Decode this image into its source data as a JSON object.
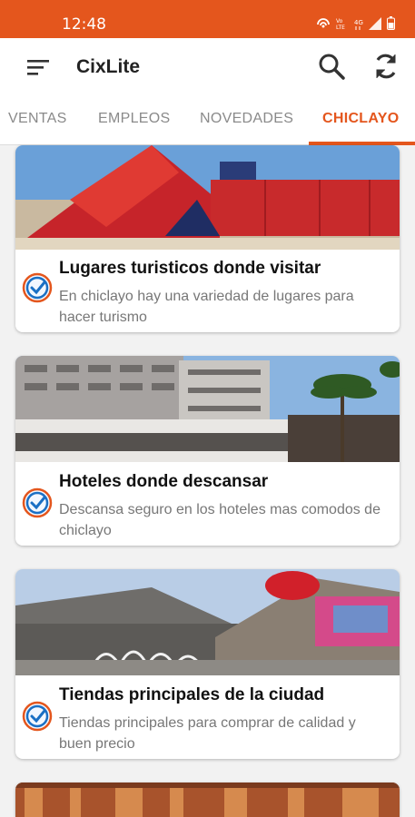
{
  "status_bar": {
    "time": "12:48",
    "icons": [
      "hotspot-icon",
      "volte-icon",
      "4g-icon",
      "signal-icon",
      "battery-icon"
    ]
  },
  "app_bar": {
    "title": "CixLite",
    "accent": "#e4561d"
  },
  "tabs": [
    {
      "label": "VENTAS",
      "active": false
    },
    {
      "label": "EMPLEOS",
      "active": false
    },
    {
      "label": "NOVEDADES",
      "active": false
    },
    {
      "label": "CHICLAYO",
      "active": true
    }
  ],
  "cards": [
    {
      "title": "Lugares turisticos donde visitar",
      "description": "En chiclayo hay una variedad de lugares para hacer turismo",
      "image": "museum-photo"
    },
    {
      "title": "Hoteles donde descansar",
      "description": "Descansa seguro en los hoteles mas comodos de chiclayo",
      "image": "hotel-photo"
    },
    {
      "title": "Tiendas principales de la ciudad",
      "description": "Tiendas principales para comprar de calidad y buen precio",
      "image": "mall-photo"
    }
  ]
}
